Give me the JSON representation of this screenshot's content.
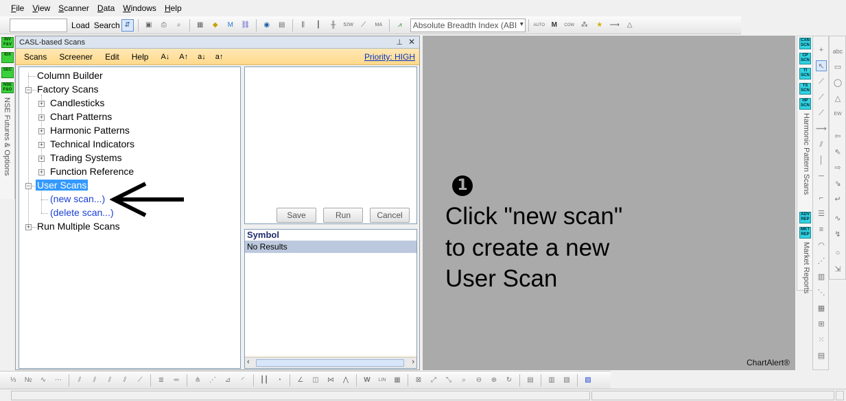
{
  "menu": [
    "File",
    "View",
    "Scanner",
    "Data",
    "Windows",
    "Help"
  ],
  "toolbar": {
    "load_label": "Load",
    "search_label": "Search",
    "breadth_combo": "Absolute Breadth Index (ABI"
  },
  "left_strip": {
    "buttons": [
      "INV F&V",
      "IDX",
      "SEC",
      "NSE F&O"
    ],
    "vertical_label": "NSE Futures & Options"
  },
  "casl_panel": {
    "title": "CASL-based Scans",
    "pin_icon": "pin-icon",
    "close_icon": "close-icon",
    "menu": [
      "Scans",
      "Screener",
      "Edit",
      "Help"
    ],
    "sort_buttons": [
      "A↓",
      "A↑",
      "a↓",
      "a↑"
    ],
    "priority": "Priority: HIGH",
    "tree": {
      "column_builder": "Column Builder",
      "factory_scans": "Factory Scans",
      "factory_children": [
        "Candlesticks",
        "Chart Patterns",
        "Harmonic Patterns",
        "Technical Indicators",
        "Trading Systems",
        "Function Reference"
      ],
      "user_scans": "User Scans",
      "new_scan": "(new scan...)",
      "delete_scan": "(delete scan...)",
      "run_multiple": "Run Multiple Scans"
    },
    "buttons": {
      "save": "Save",
      "run": "Run",
      "cancel": "Cancel"
    },
    "results": {
      "header": "Symbol",
      "row": "No Results"
    }
  },
  "chart": {
    "step_number": "1",
    "instruction_lines": [
      "Click \"new scan\"",
      "to create a new",
      "User Scan"
    ],
    "brand": "ChartAlert®"
  },
  "right_strip": {
    "buttons": [
      "CAN SCN",
      "CP SCN",
      "TI SCN",
      "TS SCN",
      "HP SCN",
      "ADV REP",
      "MKT REP"
    ],
    "labels": [
      "Harmonic Pattern Scans",
      "Market Reports"
    ]
  },
  "colors": {
    "chart_bg": "#aaaaaa",
    "selection": "#3399ff",
    "menu_bar": "#ffd98a",
    "link": "#1a3fd6"
  }
}
